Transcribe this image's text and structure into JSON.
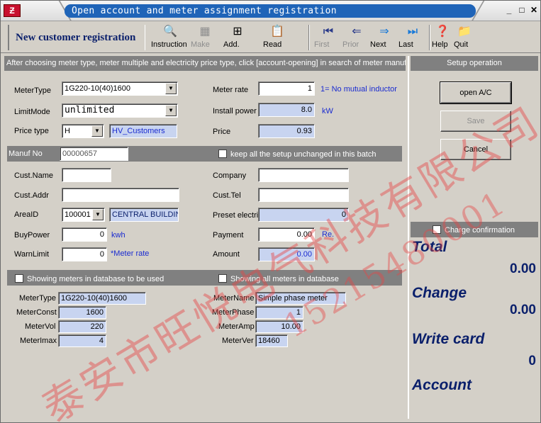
{
  "window": {
    "title": "Open account and meter assignment registration"
  },
  "toolbar": {
    "title": "New customer registration",
    "buttons": [
      {
        "label": "Instruction",
        "icon": "magnifier-document-icon"
      },
      {
        "label": "Make",
        "icon": "make-document-icon"
      },
      {
        "label": "Add.",
        "icon": "add-document-icon"
      },
      {
        "label": "Read",
        "icon": "read-card-icon"
      },
      {
        "label": "First",
        "icon": "first-record-icon"
      },
      {
        "label": "Prior",
        "icon": "prior-arrow-icon"
      },
      {
        "label": "Next",
        "icon": "next-arrow-icon"
      },
      {
        "label": "Last",
        "icon": "last-record-icon"
      },
      {
        "label": "Help",
        "icon": "help-icon"
      },
      {
        "label": "Quit",
        "icon": "quit-folder-icon"
      }
    ]
  },
  "notice": "After choosing meter type, meter multiple and electricity price type, click [account-opening] in search of meter manufactu",
  "form": {
    "meter_type_label": "MeterType",
    "meter_type_value": "1G220-10(40)1600",
    "limit_mode_label": "LimitMode",
    "limit_mode_value": "unlimited",
    "price_type_label": "Price type",
    "price_type_value": "H",
    "price_type_name": "HV_Customers",
    "meter_rate_label": "Meter rate",
    "meter_rate_value": "1",
    "meter_rate_note": "1= No mutual inductor",
    "install_power_label": "Install power",
    "install_power_value": "8.0",
    "install_power_unit": "kW",
    "price_label": "Price",
    "price_value": "0.93"
  },
  "manuf": {
    "label": "Manuf No",
    "value": "00000657",
    "keep_setup_label": "keep all the setup unchanged in this batch"
  },
  "customer": {
    "name_label": "Cust.Name",
    "name_value": "",
    "addr_label": "Cust.Addr",
    "addr_value": "",
    "area_label": "AreaID",
    "area_value": "100001",
    "area_name": "CENTRAL BUILDIN",
    "buy_power_label": "BuyPower",
    "buy_power_value": "0",
    "buy_power_unit": "kwh",
    "warn_limit_label": "WarnLimit",
    "warn_limit_value": "0",
    "warn_limit_note": "*Meter rate",
    "company_label": "Company",
    "company_value": "",
    "tel_label": "Cust.Tel",
    "tel_value": "",
    "preset_label": "Preset electric",
    "preset_value": "0",
    "payment_label": "Payment",
    "payment_value": "0.00",
    "payment_unit": "Re.",
    "amount_label": "Amount",
    "amount_value": "0.00"
  },
  "meters_section": {
    "db_used_label": "Showing meters in database to be used",
    "all_meters_label": "Showing all meters in database"
  },
  "meter_info": {
    "type_label": "MeterType",
    "type_value": "1G220-10(40)1600",
    "const_label": "MeterConst",
    "const_value": "1600",
    "vol_label": "MeterVol",
    "vol_value": "220",
    "imax_label": "MeterImax",
    "imax_value": "4",
    "name_label": "MeterName",
    "name_value": "Simple phase meter",
    "phase_label": "MeterPhase",
    "phase_value": "1",
    "amp_label": "MeterAmp",
    "amp_value": "10.00",
    "ver_label": "MeterVer",
    "ver_value": "18460"
  },
  "setup": {
    "header": "Setup operation",
    "open_label": "open A/C",
    "save_label": "Save",
    "cancel_label": "Cancel",
    "charge_confirm_label": "Charge confirmation"
  },
  "summary": {
    "total_label": "Total",
    "total_value": "0.00",
    "change_label": "Change",
    "change_value": "0.00",
    "write_card_label": "Write card",
    "write_card_value": "0",
    "account_label": "Account"
  },
  "watermark": {
    "company": "泰安市旺悦电气科技有限公司",
    "phone": "15215480001"
  },
  "colors": {
    "title_blue": "#1f64b8",
    "highlight_field": "#c8d4f0",
    "dark_navy": "#0a1f6b",
    "watermark_red": "#e64646"
  }
}
